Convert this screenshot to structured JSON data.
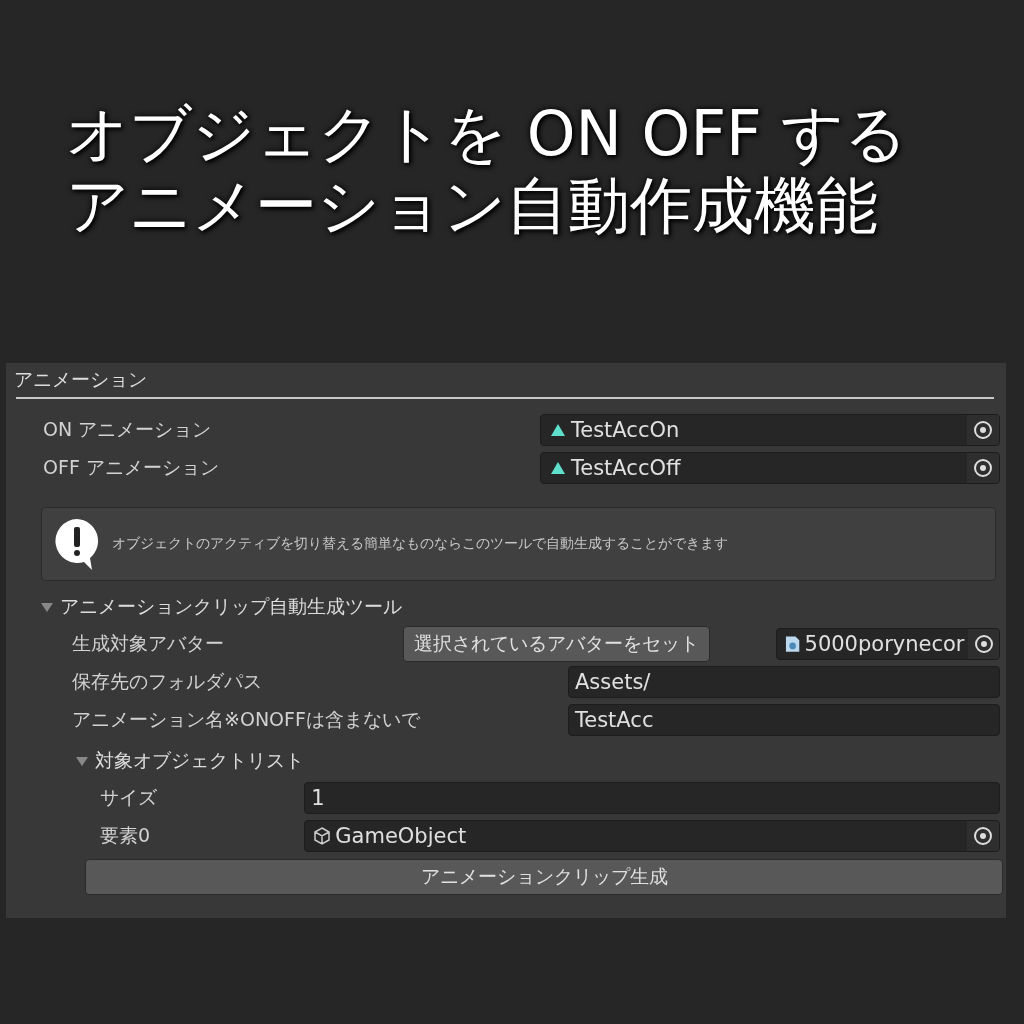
{
  "headline": [
    "オブジェクトを ON OFF する",
    "アニメーション自動作成機能"
  ],
  "panel": {
    "title": "アニメーション",
    "fields": [
      {
        "label": "ON アニメーション",
        "value": "TestAccOn"
      },
      {
        "label": "OFF アニメーション",
        "value": "TestAccOff"
      }
    ],
    "help_box": {
      "text": "オブジェクトのアクティブを切り替える簡単なものならこのツールで自動生成することができます"
    },
    "tool": {
      "label": "アニメーションクリップ自動生成ツール",
      "expanded": true,
      "avatar": {
        "label": "生成対象アバター",
        "button": "選択されているアバターをセット",
        "value": "5000porynecor"
      },
      "folder": {
        "label": "保存先のフォルダパス",
        "value": "Assets/"
      },
      "name": {
        "label": "アニメーション名※ONOFFは含まないで",
        "value": "TestAcc"
      },
      "object_list": {
        "label": "対象オブジェクトリスト",
        "expanded": true,
        "size": {
          "label": "サイズ",
          "value": "1"
        },
        "elements": [
          {
            "label": "要素0",
            "value": "GameObject"
          }
        ]
      },
      "generate_button": "アニメーションクリップ生成"
    }
  }
}
